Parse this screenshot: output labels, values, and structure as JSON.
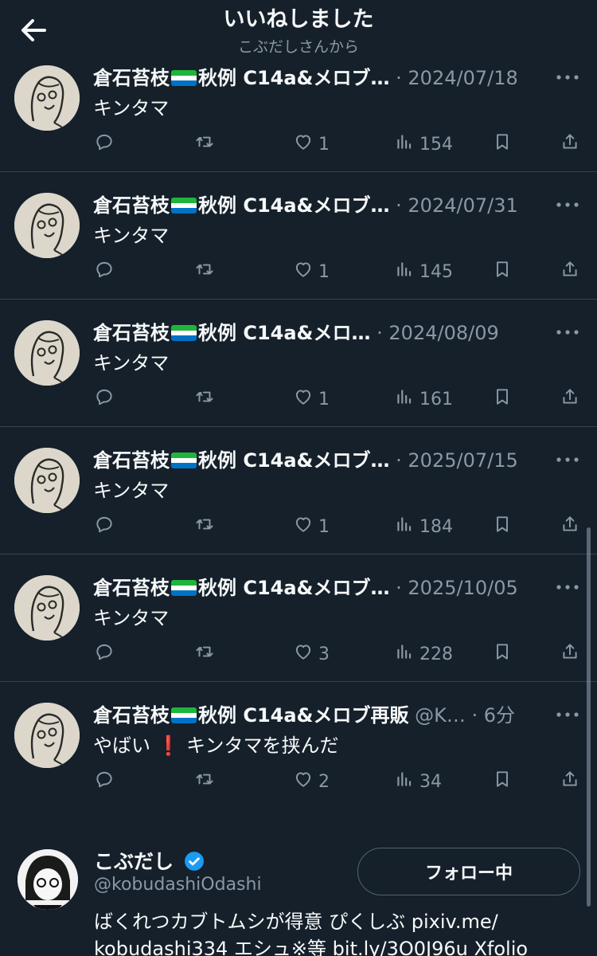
{
  "header": {
    "title": "いいねしました",
    "subtitle": "こぶだしさんから"
  },
  "tweets": [
    {
      "name": "倉石苔枝",
      "name_suffix": "秋例 C14a&メロブ…",
      "meta": "· 2024/07/18",
      "text": "キンタマ",
      "replies": "",
      "retweets": "",
      "likes": "1",
      "views": "154"
    },
    {
      "name": "倉石苔枝",
      "name_suffix": "秋例 C14a&メロブ…",
      "meta": "· 2024/07/31",
      "text": "キンタマ",
      "replies": "",
      "retweets": "",
      "likes": "1",
      "views": "145"
    },
    {
      "name": "倉石苔枝",
      "name_suffix": "秋例 C14a&メロ…",
      "meta": "· 2024/08/09",
      "text": "キンタマ",
      "replies": "",
      "retweets": "",
      "likes": "1",
      "views": "161"
    },
    {
      "name": "倉石苔枝",
      "name_suffix": "秋例 C14a&メロブ…",
      "meta": "· 2025/07/15",
      "text": "キンタマ",
      "replies": "",
      "retweets": "",
      "likes": "1",
      "views": "184"
    },
    {
      "name": "倉石苔枝",
      "name_suffix": "秋例 C14a&メロブ…",
      "meta": "· 2025/10/05",
      "text": "キンタマ",
      "replies": "",
      "retweets": "",
      "likes": "3",
      "views": "228"
    },
    {
      "name": "倉石苔枝",
      "name_suffix": "秋例 C14a&メロブ再販",
      "meta": "@K… · 6分",
      "text_before": "やばい",
      "text_emoji": "❗",
      "text_after": "キンタマを挟んだ",
      "replies": "",
      "retweets": "",
      "likes": "2",
      "views": "34"
    }
  ],
  "suggestion": {
    "name": "こぶだし",
    "handle": "@kobudashiOdashi",
    "follow_label": "フォロー中",
    "bio_line1": "ばくれつカブトムシが得意 ぴくしぶ pixiv.me/",
    "bio_line2": "kobudashi334 エシュ※等 bit.ly/3O0J96u Xfolio"
  },
  "colors": {
    "background": "#15202b",
    "text": "#f7f9f9",
    "muted": "#8b98a5",
    "divider": "#38444d",
    "verified": "#1d9bf0"
  },
  "icons": [
    "back-arrow-icon",
    "more-icon",
    "reply-icon",
    "retweet-icon",
    "like-icon",
    "views-icon",
    "bookmark-icon",
    "share-icon",
    "verified-icon",
    "flag-icon"
  ]
}
